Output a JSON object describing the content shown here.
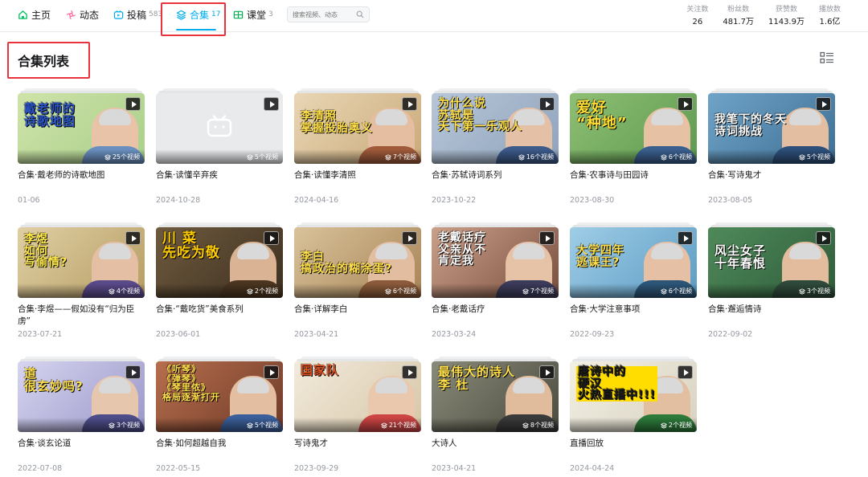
{
  "nav": {
    "tabs": [
      {
        "label": "主页",
        "count": "",
        "icon": "home-icon"
      },
      {
        "label": "动态",
        "count": "",
        "icon": "dynamic-icon"
      },
      {
        "label": "投稿",
        "count": "583",
        "icon": "upload-icon"
      },
      {
        "label": "合集",
        "count": "17",
        "icon": "collection-icon"
      },
      {
        "label": "课堂",
        "count": "3",
        "icon": "classroom-icon"
      }
    ],
    "search_placeholder": "搜索视频、动态",
    "stats": [
      {
        "label": "关注数",
        "value": "26"
      },
      {
        "label": "粉丝数",
        "value": "481.7万"
      },
      {
        "label": "获赞数",
        "value": "1143.9万"
      },
      {
        "label": "播放数",
        "value": "1.6亿"
      }
    ]
  },
  "section": {
    "title": "合集列表"
  },
  "collections": [
    {
      "title": "合集·戴老师的诗歌地图",
      "date": "01-06",
      "badge": "25个视频",
      "caption": "戴老师的\n诗歌地图"
    },
    {
      "title": "合集·读懂辛弃疾",
      "date": "2024-10-28",
      "badge": "5个视频",
      "caption": ""
    },
    {
      "title": "合集·读懂李清照",
      "date": "2024-04-16",
      "badge": "7个视频",
      "caption": "李清照\n掌握投胎奥义"
    },
    {
      "title": "合集·苏轼诗词系列",
      "date": "2023-10-22",
      "badge": "16个视频",
      "caption": "为什么说\n苏轼是\n天下第一乐观人"
    },
    {
      "title": "合集·农事诗与田园诗",
      "date": "2023-08-30",
      "badge": "6个视频",
      "caption": "爱好\n“种地”"
    },
    {
      "title": "合集·写诗鬼才",
      "date": "2023-08-05",
      "badge": "5个视频",
      "caption": "我笔下的冬天\n诗词挑战"
    },
    {
      "title": "合集·李煜——假如没有“归为臣虏”",
      "date": "2023-07-21",
      "badge": "4个视频",
      "caption": "李煜\n如何\n写偷情?"
    },
    {
      "title": "合集·“戴吃货”美食系列",
      "date": "2023-06-01",
      "badge": "2个视频",
      "caption": "川 菜\n先吃为敬"
    },
    {
      "title": "合集·详解李白",
      "date": "2023-04-21",
      "badge": "6个视频",
      "caption": "李白\n搞政治的糊涂蛋?"
    },
    {
      "title": "合集·老戴话疗",
      "date": "2023-03-24",
      "badge": "7个视频",
      "caption": "老戴话疗\n父亲从不\n肯定我"
    },
    {
      "title": "合集·大学注意事项",
      "date": "2022-09-23",
      "badge": "6个视频",
      "caption": "大学四年\n逃课王?"
    },
    {
      "title": "合集·邂逅情诗",
      "date": "2022-09-02",
      "badge": "3个视频",
      "caption": "风尘女子\n十年春恨"
    },
    {
      "title": "合集·谈玄论道",
      "date": "2022-07-08",
      "badge": "3个视频",
      "caption": "道\n很玄妙吗?"
    },
    {
      "title": "合集·如何超越自我",
      "date": "2022-05-15",
      "badge": "5个视频",
      "caption": "《听琴》\n《弹琴》\n《琴里侬》\n格局逐渐打开"
    },
    {
      "title": "写诗鬼才",
      "date": "2023-09-29",
      "badge": "21个视频",
      "caption": "国家队"
    },
    {
      "title": "大诗人",
      "date": "2023-04-21",
      "badge": "8个视频",
      "caption": "最伟大的诗人\n李 杜"
    },
    {
      "title": "直播回放",
      "date": "2024-04-24",
      "badge": "2个视频",
      "caption": "唐诗中的\n硬汉\n火热直播中!!!"
    }
  ],
  "colors": {
    "accent": "#00aeec",
    "highlight": "#e8323c"
  }
}
